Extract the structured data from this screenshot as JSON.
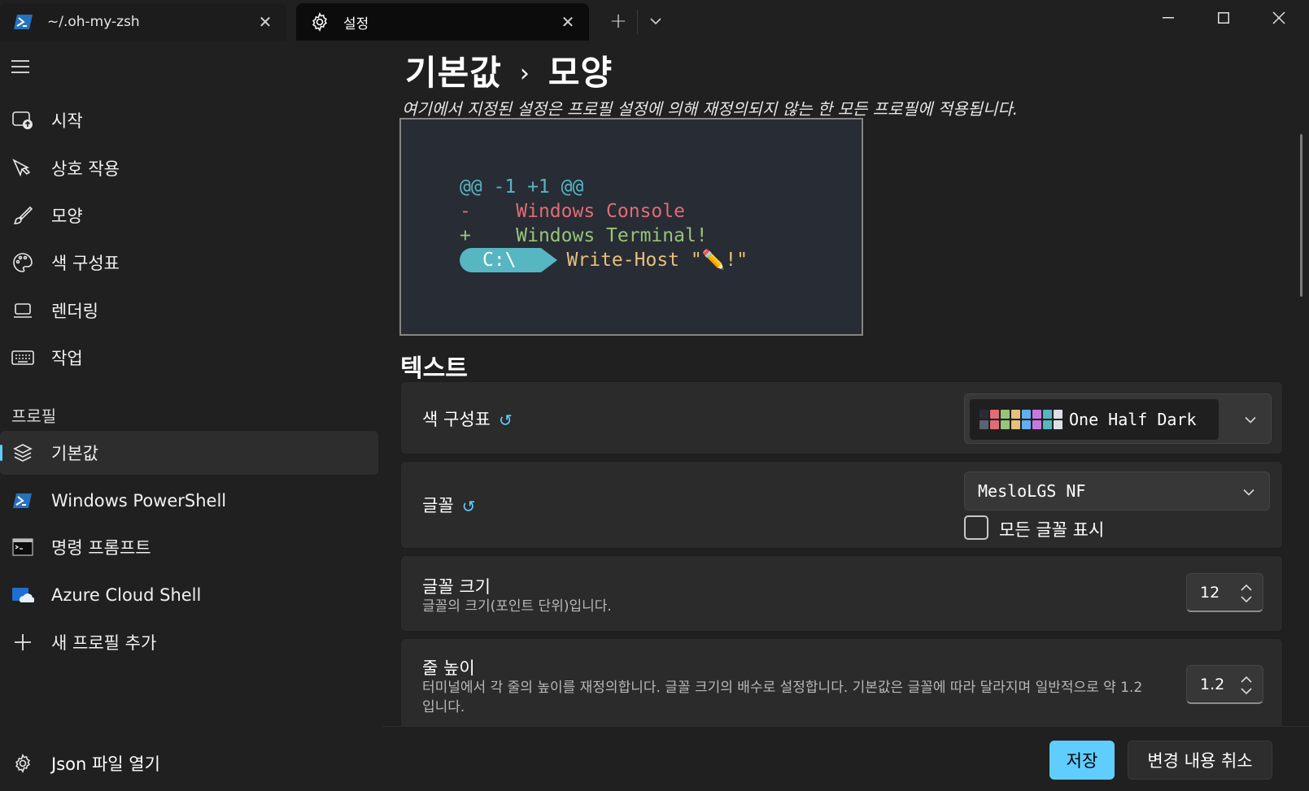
{
  "tabs": [
    {
      "label": "~/.oh-my-zsh",
      "icon": "powershell-icon"
    },
    {
      "label": "설정",
      "icon": "gear-icon"
    }
  ],
  "sidebar": {
    "items": [
      {
        "label": "시작",
        "icon": "startup-icon"
      },
      {
        "label": "상호 작용",
        "icon": "pointer-icon"
      },
      {
        "label": "모양",
        "icon": "brush-icon"
      },
      {
        "label": "색 구성표",
        "icon": "palette-icon"
      },
      {
        "label": "렌더링",
        "icon": "laptop-icon"
      },
      {
        "label": "작업",
        "icon": "keyboard-icon"
      }
    ],
    "profiles_header": "프로필",
    "profiles": [
      {
        "label": "기본값",
        "icon": "layers-icon",
        "selected": true
      },
      {
        "label": "Windows PowerShell",
        "icon": "powershell-icon"
      },
      {
        "label": "명령 프롬프트",
        "icon": "cmd-icon"
      },
      {
        "label": "Azure Cloud Shell",
        "icon": "azure-icon"
      },
      {
        "label": "새 프로필 추가",
        "icon": "plus-icon"
      }
    ],
    "json_label": "Json 파일 열기"
  },
  "page": {
    "breadcrumb_parent": "기본값",
    "breadcrumb_sep": "›",
    "breadcrumb_current": "모양",
    "subtitle": "여기에서 지정된 설정은 프로필 설정에 의해 재정의되지 않는 한 모든 프로필에 적용됩니다."
  },
  "preview": {
    "line1": "@@ -1 +1 @@",
    "line2_sign": "-",
    "line2_text": "Windows Console",
    "line3_sign": "+",
    "line3_text": "Windows Terminal!",
    "prompt": "C:\\",
    "command": "Write-Host \"✏️!\""
  },
  "text_section": {
    "title": "텍스트",
    "color_scheme": {
      "label": "색 구성표",
      "value": "One Half Dark",
      "swatches": [
        "#282c34",
        "#e06c75",
        "#98c379",
        "#e5c07b",
        "#61afef",
        "#c678dd",
        "#56b6c2",
        "#dcdfe4",
        "#5a6374",
        "#e06c75",
        "#98c379",
        "#e5c07b",
        "#61afef",
        "#c678dd",
        "#56b6c2",
        "#dcdfe4"
      ]
    },
    "font": {
      "label": "글꼴",
      "value": "MesloLGS NF",
      "checkbox_label": "모든 글꼴 표시"
    },
    "font_size": {
      "label": "글꼴 크기",
      "desc": "글꼴의 크기(포인트 단위)입니다.",
      "value": "12"
    },
    "line_height": {
      "label": "줄 높이",
      "desc": "터미널에서 각 줄의 높이를 재정의합니다. 글꼴 크기의 배수로 설정합니다. 기본값은 글꼴에 따라 달라지며 일반적으로 약 1.2입니다.",
      "value": "1.2"
    }
  },
  "footer": {
    "save": "저장",
    "discard": "변경 내용 취소"
  },
  "colors": {
    "accent": "#60cdff",
    "background": "#202020",
    "card": "#2b2b2b"
  }
}
